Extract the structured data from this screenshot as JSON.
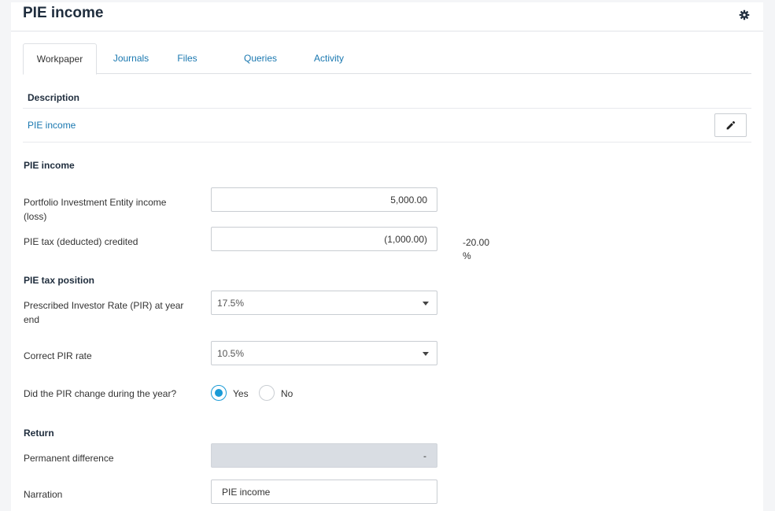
{
  "page": {
    "title": "PIE income"
  },
  "tabs": [
    "Workpaper",
    "Journals",
    "Files",
    "Queries",
    "Activity"
  ],
  "description": {
    "heading": "Description",
    "link": "PIE income"
  },
  "pie_income": {
    "heading": "PIE income",
    "entity_income_label": "Portfolio Investment Entity income (loss)",
    "entity_income_value": "5,000.00",
    "tax_credited_label": "PIE tax (deducted) credited",
    "tax_credited_value": "(1,000.00)",
    "tax_pct_value": "-20.00",
    "tax_pct_unit": "%"
  },
  "tax_position": {
    "heading": "PIE tax position",
    "pir_label": "Prescribed Investor Rate (PIR) at year end",
    "pir_value": "17.5%",
    "correct_pir_label": "Correct PIR rate",
    "correct_pir_value": "10.5%",
    "pir_change_label": "Did the PIR change during the year?",
    "yes_label": "Yes",
    "no_label": "No",
    "pir_changed": "Yes"
  },
  "return": {
    "heading": "Return",
    "perm_diff_label": "Permanent difference",
    "perm_diff_value": "-",
    "narration_label": "Narration",
    "narration_value": "PIE income"
  },
  "icons": {
    "settings": "gear-icon",
    "edit": "pencil-icon",
    "dropdown": "caret-down-icon"
  },
  "colors": {
    "link": "#1a78b0",
    "radio_accent": "#1a9bd7",
    "disabled_fill": "#d9dde3"
  }
}
